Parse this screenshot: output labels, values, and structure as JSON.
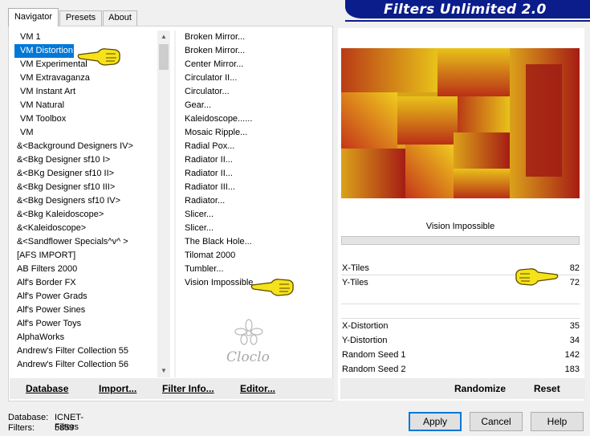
{
  "tabs": [
    "Navigator",
    "Presets",
    "About"
  ],
  "banner_title": "Filters Unlimited 2.0",
  "categories": [
    "VM 1",
    "VM Distortion",
    "VM Experimental",
    "VM Extravaganza",
    "VM Instant Art",
    "VM Natural",
    "VM Toolbox",
    "VM",
    "&<Background Designers IV>",
    "&<Bkg Designer sf10 I>",
    "&<BKg Designer sf10 II>",
    "&<Bkg Designer sf10 III>",
    "&<Bkg Designers sf10 IV>",
    "&<Bkg Kaleidoscope>",
    "&<Kaleidoscope>",
    "&<Sandflower Specials^v^ >",
    "[AFS IMPORT]",
    "AB Filters 2000",
    "Alf's Border FX",
    "Alf's Power Grads",
    "Alf's Power Sines",
    "Alf's Power Toys",
    "AlphaWorks",
    "Andrew's Filter Collection 55",
    "Andrew's Filter Collection 56"
  ],
  "selected_category": "VM Distortion",
  "filters": [
    "Broken Mirror...",
    "Broken Mirror...",
    "Center Mirror...",
    "Circulator II...",
    "Circulator...",
    "Gear...",
    "Kaleidoscope......",
    "Mosaic Ripple...",
    "Radial Pox...",
    "Radiator II...",
    "Radiator II...",
    "Radiator III...",
    "Radiator...",
    "Slicer...",
    "Slicer...",
    "The Black Hole...",
    "Tilomat 2000",
    "Tumbler...",
    "Vision Impossible"
  ],
  "watermark_text": "Cloclo",
  "left_buttons": {
    "database": "Database",
    "import": "Import...",
    "filter_info": "Filter Info...",
    "editor": "Editor..."
  },
  "filter_name": "Vision Impossible",
  "params_top": [
    {
      "label": "X-Tiles",
      "value": "82"
    },
    {
      "label": "Y-Tiles",
      "value": "72"
    }
  ],
  "params_bottom": [
    {
      "label": "X-Distortion",
      "value": "35"
    },
    {
      "label": "Y-Distortion",
      "value": "34"
    },
    {
      "label": "Random Seed 1",
      "value": "142"
    },
    {
      "label": "Random Seed 2",
      "value": "183"
    }
  ],
  "right_buttons": {
    "randomize": "Randomize",
    "reset": "Reset"
  },
  "footer": {
    "database_label": "Database:",
    "database_value": "ICNET-Filters",
    "filters_label": "Filters:",
    "filters_value": "5859"
  },
  "dialog_buttons": {
    "apply": "Apply",
    "cancel": "Cancel",
    "help": "Help"
  },
  "colors": {
    "banner": "#0b1d8a",
    "selection": "#0078d7",
    "preview_red": "#b01e14",
    "preview_yellow": "#e8c21a"
  }
}
